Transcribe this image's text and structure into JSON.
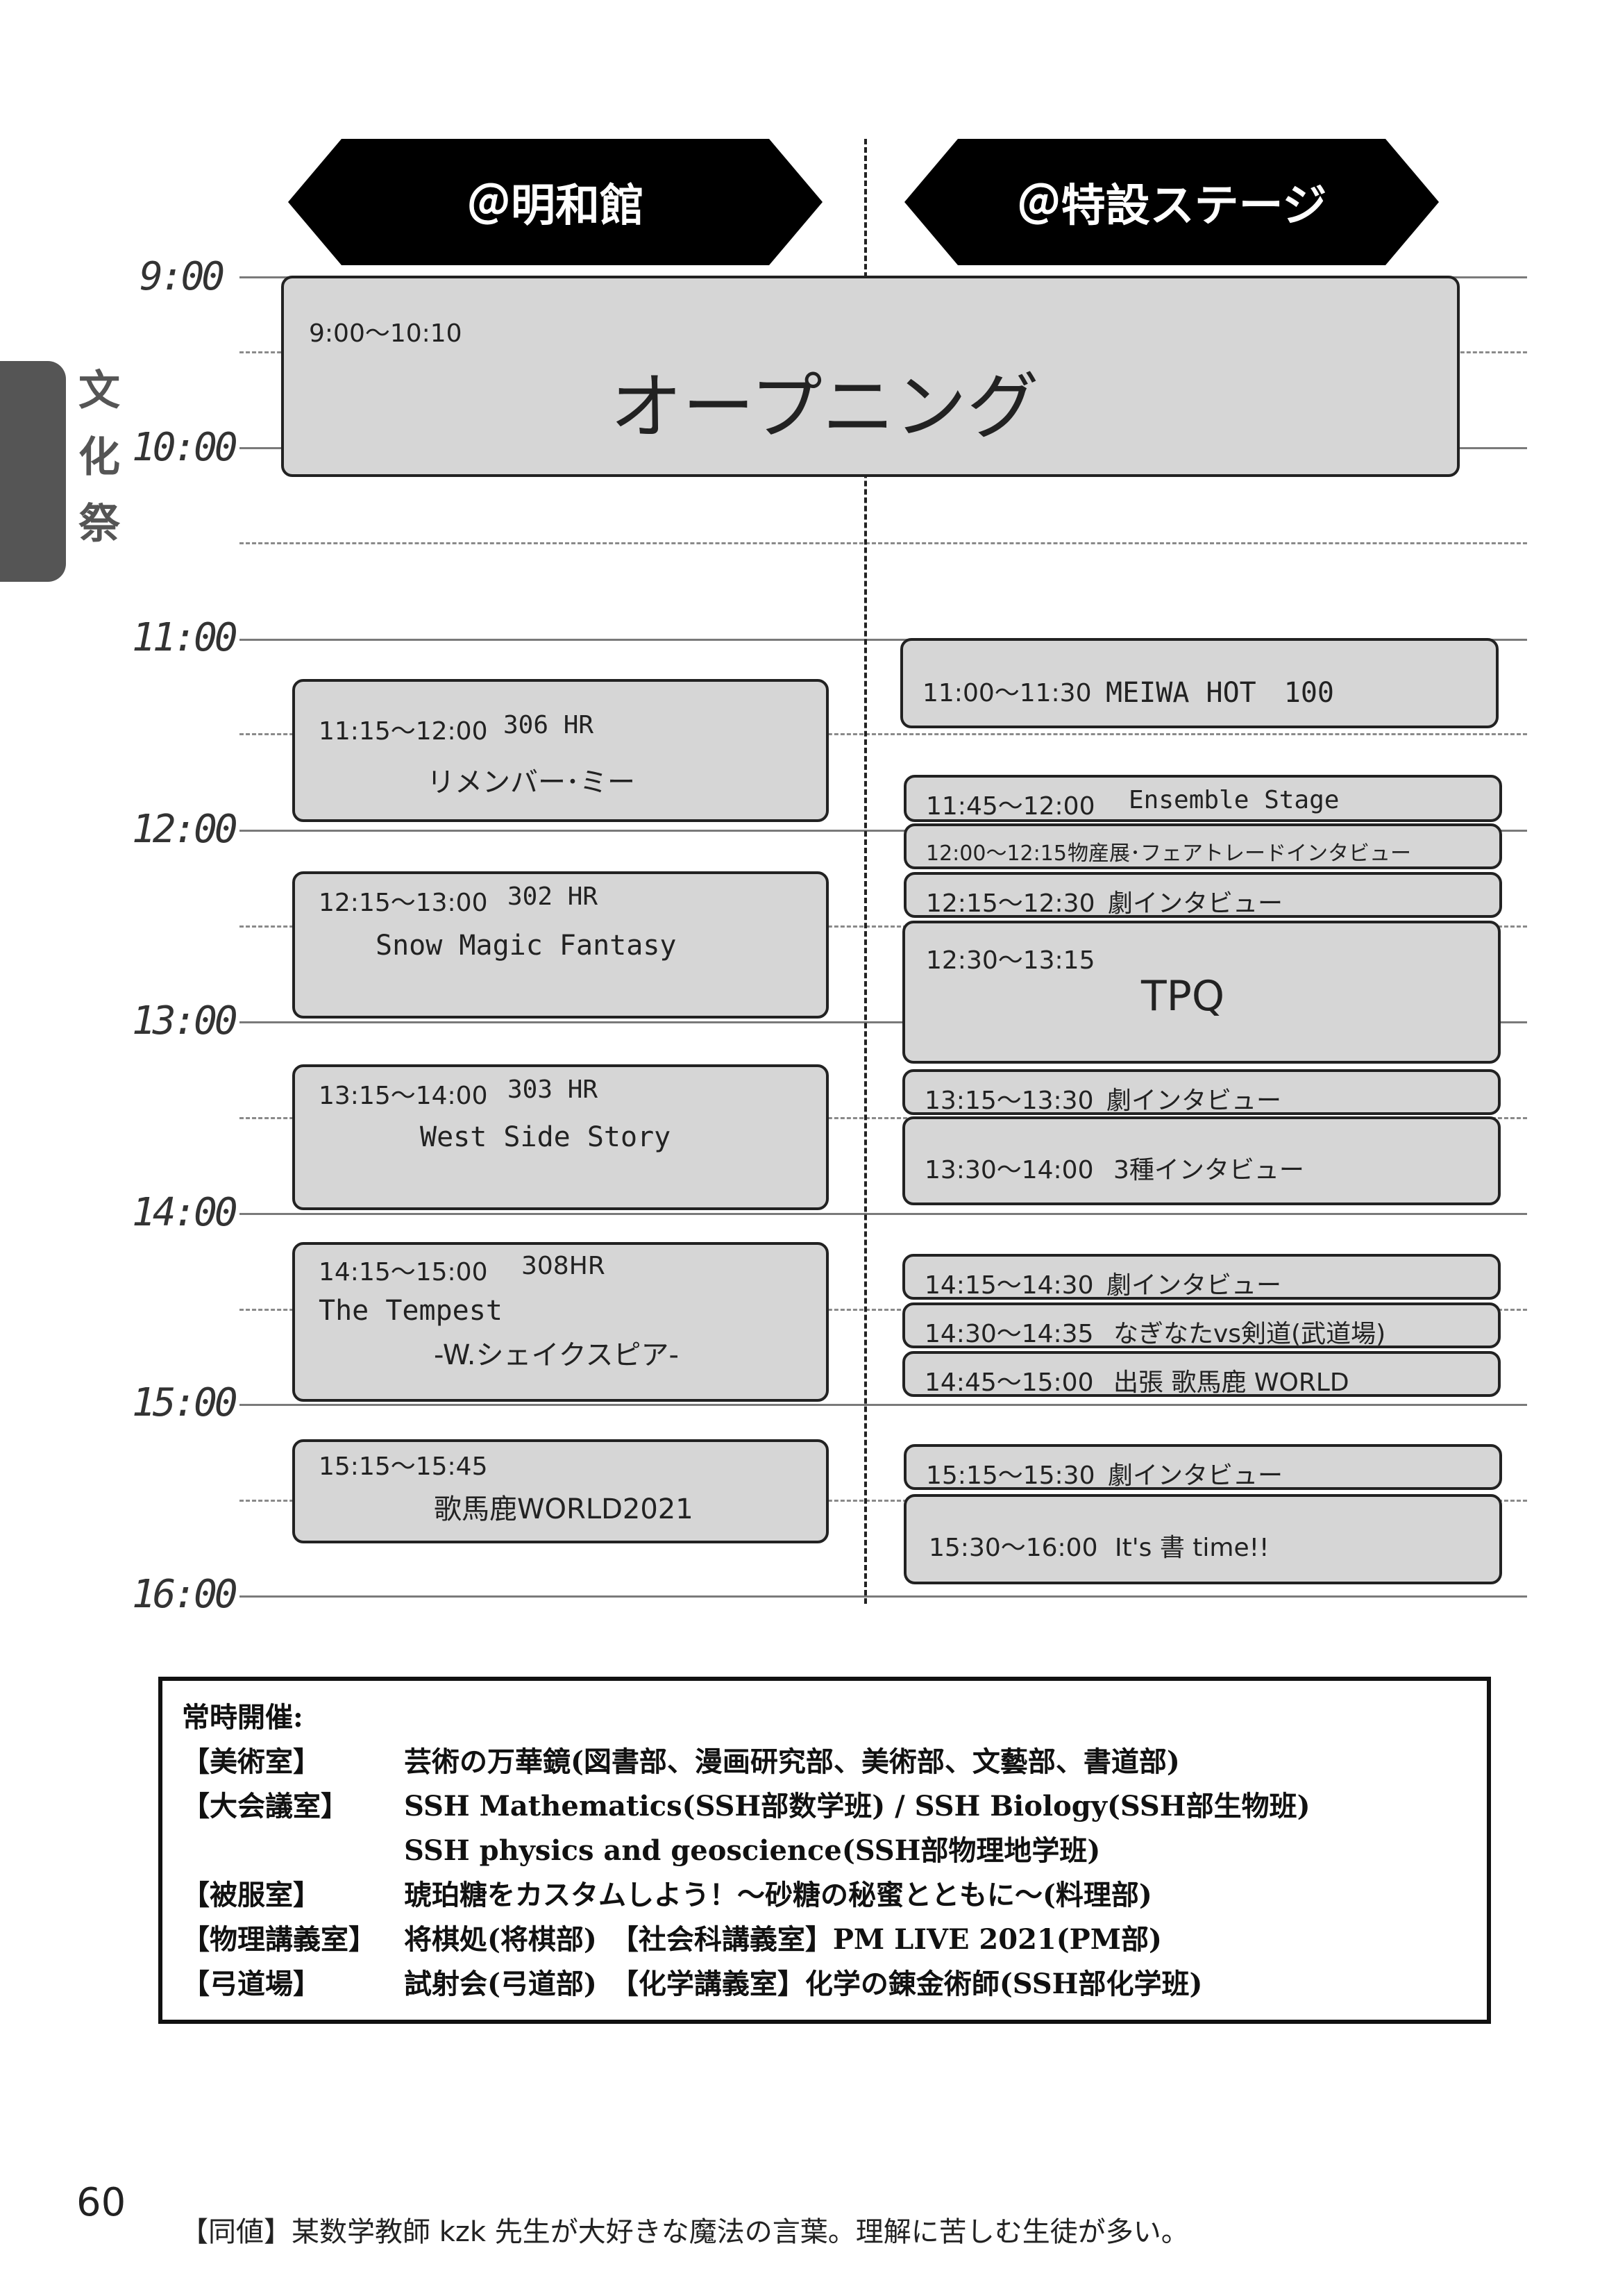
{
  "section_label": [
    "文",
    "化",
    "祭"
  ],
  "venues": {
    "left": "＠明和館",
    "right": "＠特設ステージ"
  },
  "time_labels": [
    "9:00",
    "10:00",
    "11:00",
    "12:00",
    "13:00",
    "14:00",
    "15:00",
    "16:00"
  ],
  "opening": {
    "time": "9:00〜10:10",
    "title": "オープニング"
  },
  "left_events": [
    {
      "time": "11:15〜12:00",
      "group": "306 HR",
      "title": "リメンバー･ミー"
    },
    {
      "time": "12:15〜13:00",
      "group": "302 HR",
      "title": "Snow Magic Fantasy"
    },
    {
      "time": "13:15〜14:00",
      "group": "303 HR",
      "title": "West Side Story"
    },
    {
      "time": "14:15〜15:00",
      "group": "308HR",
      "title": "The Tempest",
      "subtitle": "-W.シェイクスピア-"
    },
    {
      "time": "15:15〜15:45",
      "group": "",
      "title": "歌馬鹿WORLD2021"
    }
  ],
  "right_events": [
    {
      "time": "11:00〜11:30",
      "title": "MEIWA HOT　100"
    },
    {
      "time": "11:45〜12:00",
      "title": "Ensemble Stage"
    },
    {
      "time": "12:00〜12:15",
      "title": "物産展･フェアトレードインタビュー"
    },
    {
      "time": "12:15〜12:30",
      "title": "劇インタビュー"
    },
    {
      "time": "12:30〜13:15",
      "title": "TPQ"
    },
    {
      "time": "13:15〜13:30",
      "title": "劇インタビュー"
    },
    {
      "time": "13:30〜14:00",
      "title": "3種インタビュー"
    },
    {
      "time": "14:15〜14:30",
      "title": "劇インタビュー"
    },
    {
      "time": "14:30〜14:35",
      "title": "なぎなたvs剣道(武道場)"
    },
    {
      "time": "14:45〜15:00",
      "title": "出張 歌馬鹿 WORLD"
    },
    {
      "time": "15:15〜15:30",
      "title": "劇インタビュー"
    },
    {
      "time": "15:30〜16:00",
      "title": "It's 書 time!!"
    }
  ],
  "always_open": {
    "heading": "常時開催:",
    "rows": [
      {
        "room": "【美術室】",
        "content": "芸術の万華鏡(図書部、漫画研究部、美術部、文藝部、書道部)"
      },
      {
        "room": "【大会議室】",
        "content": "SSH Mathematics(SSH部数学班) / SSH Biology(SSH部生物班)"
      },
      {
        "room": "",
        "content": "SSH physics and geoscience(SSH部物理地学班)"
      },
      {
        "room": "【被服室】",
        "content": "琥珀糖をカスタムしよう！〜砂糖の秘蜜とともに〜(料理部)"
      },
      {
        "room": "【物理講義室】",
        "content": "将棋処(将棋部)　【社会科講義室】PM LIVE 2021(PM部)"
      },
      {
        "room": "【弓道場】",
        "content": "試射会(弓道部)　【化学講義室】化学の錬金術師(SSH部化学班)"
      }
    ]
  },
  "page_number": "60",
  "footnote": "【同値】某数学教師 kzk 先生が大好きな魔法の言葉。理解に苦しむ生徒が多い。"
}
